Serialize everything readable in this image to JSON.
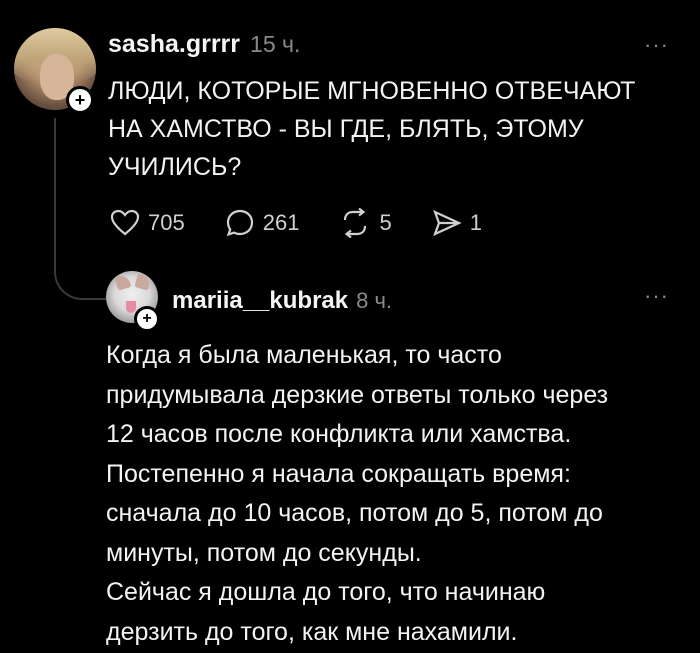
{
  "post": {
    "username": "sasha.grrrr",
    "time": "15 ч.",
    "more": "···",
    "lines": [
      "ЛЮДИ, КОТОРЫЕ МГНОВЕННО ОТВЕЧАЮТ",
      "НА ХАМСТВО - ВЫ ГДЕ, БЛЯТЬ, ЭТОМУ",
      "УЧИЛИСЬ?"
    ],
    "likes": "705",
    "comments": "261",
    "reposts": "5",
    "shares": "1"
  },
  "reply": {
    "username": "mariia__kubrak",
    "time": "8 ч.",
    "more": "···",
    "lines": [
      "Когда я была маленькая, то часто",
      "придумывала дерзкие ответы только через",
      "12 часов после конфликта или хамства.",
      "Постепенно я начала сокращать время:",
      "сначала до 10 часов, потом до 5, потом до",
      "минуты, потом до секунды.",
      "Сейчас я дошла до того, что начинаю",
      "дерзить до того, как мне нахамили."
    ]
  },
  "icons": {
    "plus": "+"
  }
}
